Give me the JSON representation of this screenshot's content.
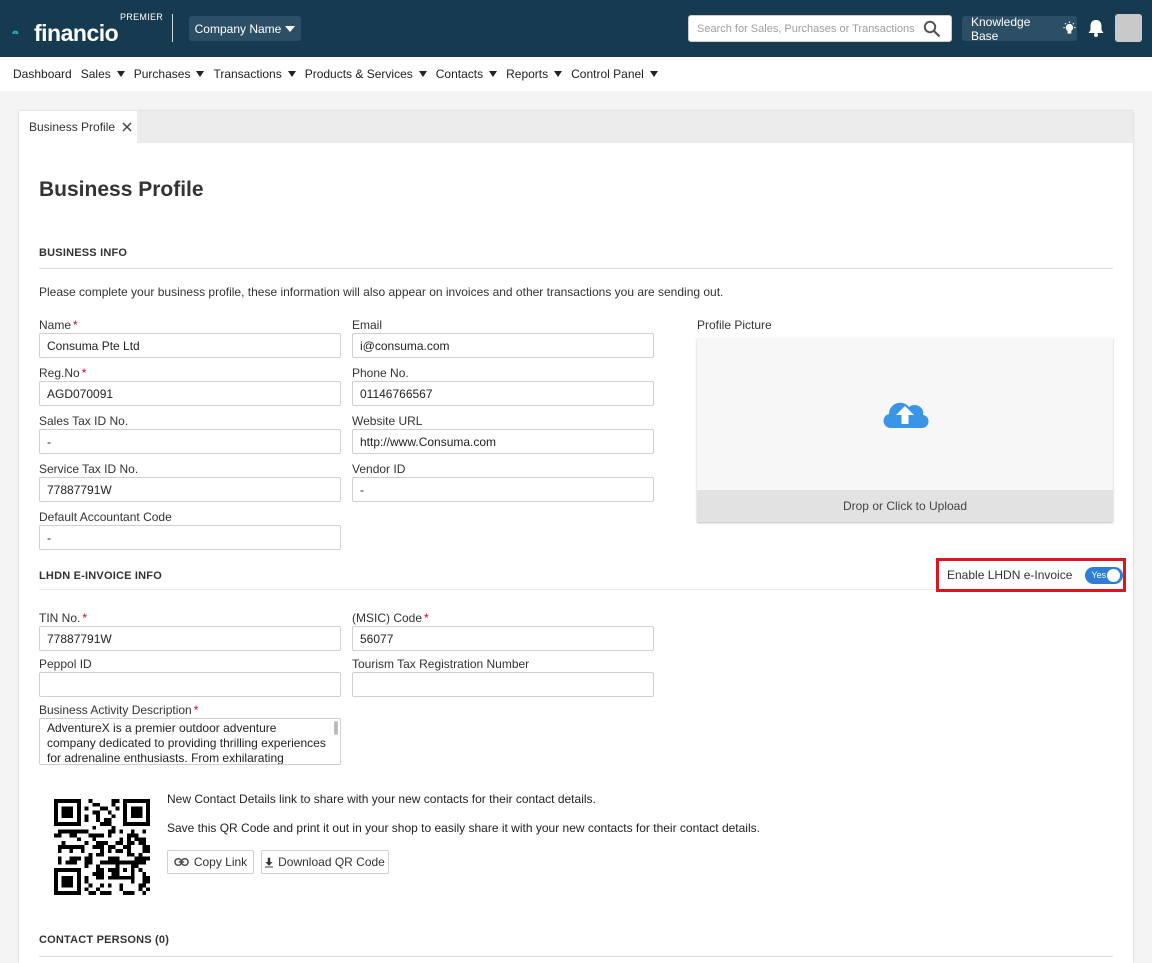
{
  "header": {
    "logo_text": "financio",
    "logo_tag": "PREMIER",
    "company_label": "Company Name",
    "search_placeholder": "Search for Sales, Purchases or Transactions",
    "kb_label": "Knowledge Base"
  },
  "nav": [
    {
      "label": "Dashboard",
      "dropdown": false
    },
    {
      "label": "Sales",
      "dropdown": true
    },
    {
      "label": "Purchases",
      "dropdown": true
    },
    {
      "label": "Transactions",
      "dropdown": true
    },
    {
      "label": "Products & Services",
      "dropdown": true
    },
    {
      "label": "Contacts",
      "dropdown": true
    },
    {
      "label": "Reports",
      "dropdown": true
    },
    {
      "label": "Control Panel",
      "dropdown": true
    }
  ],
  "tab": {
    "label": "Business Profile"
  },
  "page": {
    "title": "Business Profile"
  },
  "business_info": {
    "heading": "BUSINESS INFO",
    "intro": "Please complete your business profile, these information will also appear on invoices and other transactions you are sending out.",
    "name": {
      "label": "Name",
      "value": "Consuma Pte Ltd"
    },
    "email": {
      "label": "Email",
      "value": "i@consuma.com"
    },
    "reg_no": {
      "label": "Reg.No",
      "value": "AGD070091"
    },
    "phone": {
      "label": "Phone No.",
      "value": "01146766567"
    },
    "sales_tax": {
      "label": "Sales Tax ID No.",
      "value": "-"
    },
    "website": {
      "label": "Website URL",
      "value": "http://www.Consuma.com"
    },
    "service_tax": {
      "label": "Service Tax ID No.",
      "value": "77887791W"
    },
    "vendor_id": {
      "label": "Vendor ID",
      "value": "-"
    },
    "accountant_code": {
      "label": "Default Accountant Code",
      "value": "-"
    },
    "profile_picture": {
      "label": "Profile Picture",
      "upload_text": "Drop or Click to Upload"
    }
  },
  "einvoice": {
    "heading": "LHDN E-INVOICE INFO",
    "toggle_label": "Enable LHDN e-Invoice",
    "toggle_value": "Yes",
    "tin": {
      "label": "TIN No.",
      "value": "77887791W"
    },
    "msic": {
      "label": "(MSIC) Code",
      "value": "56077"
    },
    "peppol": {
      "label": "Peppol ID",
      "value": ""
    },
    "tourism": {
      "label": "Tourism Tax Registration Number",
      "value": ""
    },
    "activity": {
      "label": "Business Activity Description",
      "value": "AdventureX is a premier outdoor adventure company dedicated to providing thrilling experiences for adrenaline enthusiasts. From exhilarating mountain"
    }
  },
  "qr": {
    "line1": "New Contact Details link to share with your new contacts for their contact details.",
    "line2": "Save this QR Code and print it out in your shop to easily share it with your new contacts for their contact details.",
    "copy_label": "Copy Link",
    "download_label": "Download QR Code"
  },
  "contacts": {
    "heading": "CONTACT PERSONS (0)"
  },
  "colors": {
    "topbar": "#163a50",
    "accent": "#2c7fd4",
    "highlight": "#e0141e",
    "required": "#d0021b"
  }
}
